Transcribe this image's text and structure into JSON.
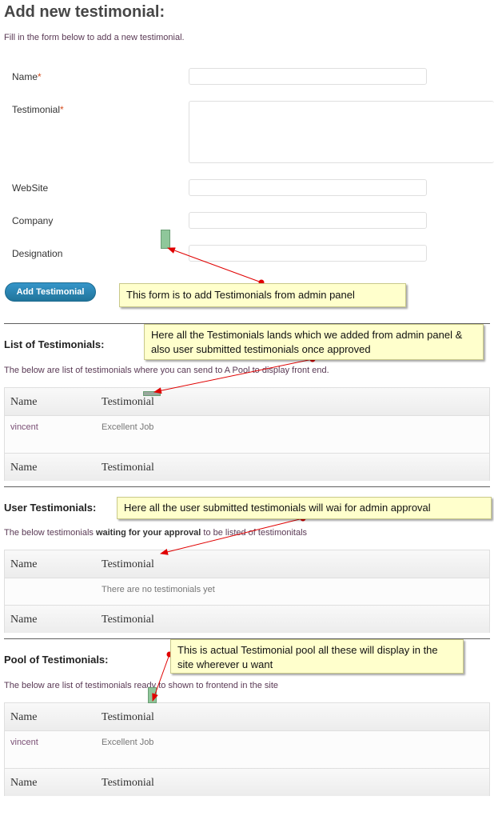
{
  "form": {
    "title": "Add new testimonial:",
    "intro": "Fill in the form below to add a new testimonial.",
    "required_mark": "*",
    "fields": [
      {
        "label": "Name",
        "required": true,
        "value": ""
      },
      {
        "label": "Testimonial",
        "required": true,
        "value": ""
      },
      {
        "label": "WebSite",
        "required": false,
        "value": ""
      },
      {
        "label": "Company",
        "required": false,
        "value": ""
      },
      {
        "label": "Designation",
        "required": false,
        "value": ""
      }
    ],
    "submit_label": "Add Testimonial"
  },
  "list_section": {
    "title": "List of Testimonials:",
    "description": "The below are list of testimonials where you can send to A Pool to display front end.",
    "columns": [
      "Name",
      "Testimonial"
    ],
    "rows": [
      {
        "name": "vincent",
        "testimonial": "Excellent Job"
      }
    ]
  },
  "user_section": {
    "title": "User Testimonials:",
    "description_pre": "The below testimonials ",
    "description_bold": "waiting for your approval",
    "description_post": " to be listed of testimonitals",
    "columns": [
      "Name",
      "Testimonial"
    ],
    "empty_text": "There are no testimonials yet"
  },
  "pool_section": {
    "title": "Pool of Testimonials:",
    "description": "The below are list of testimonials ready to shown to frontend in the site",
    "columns": [
      "Name",
      "Testimonial"
    ],
    "rows": [
      {
        "name": "vincent",
        "testimonial": "Excellent Job"
      }
    ]
  },
  "annotations": {
    "form_note": "This form is to add Testimonials from admin panel",
    "list_note": "Here all the Testimonials lands which we added from admin panel & also user submitted testimonials once approved",
    "user_note": "Here all the user submitted testimonials will wai for admin approval",
    "pool_note": "This is actual Testimonial pool all these will display in the site wherever u want"
  },
  "colors": {
    "accent": "#21759b",
    "required": "#d54e21",
    "note_bg": "#ffffcc",
    "arrow": "#ff0000"
  }
}
